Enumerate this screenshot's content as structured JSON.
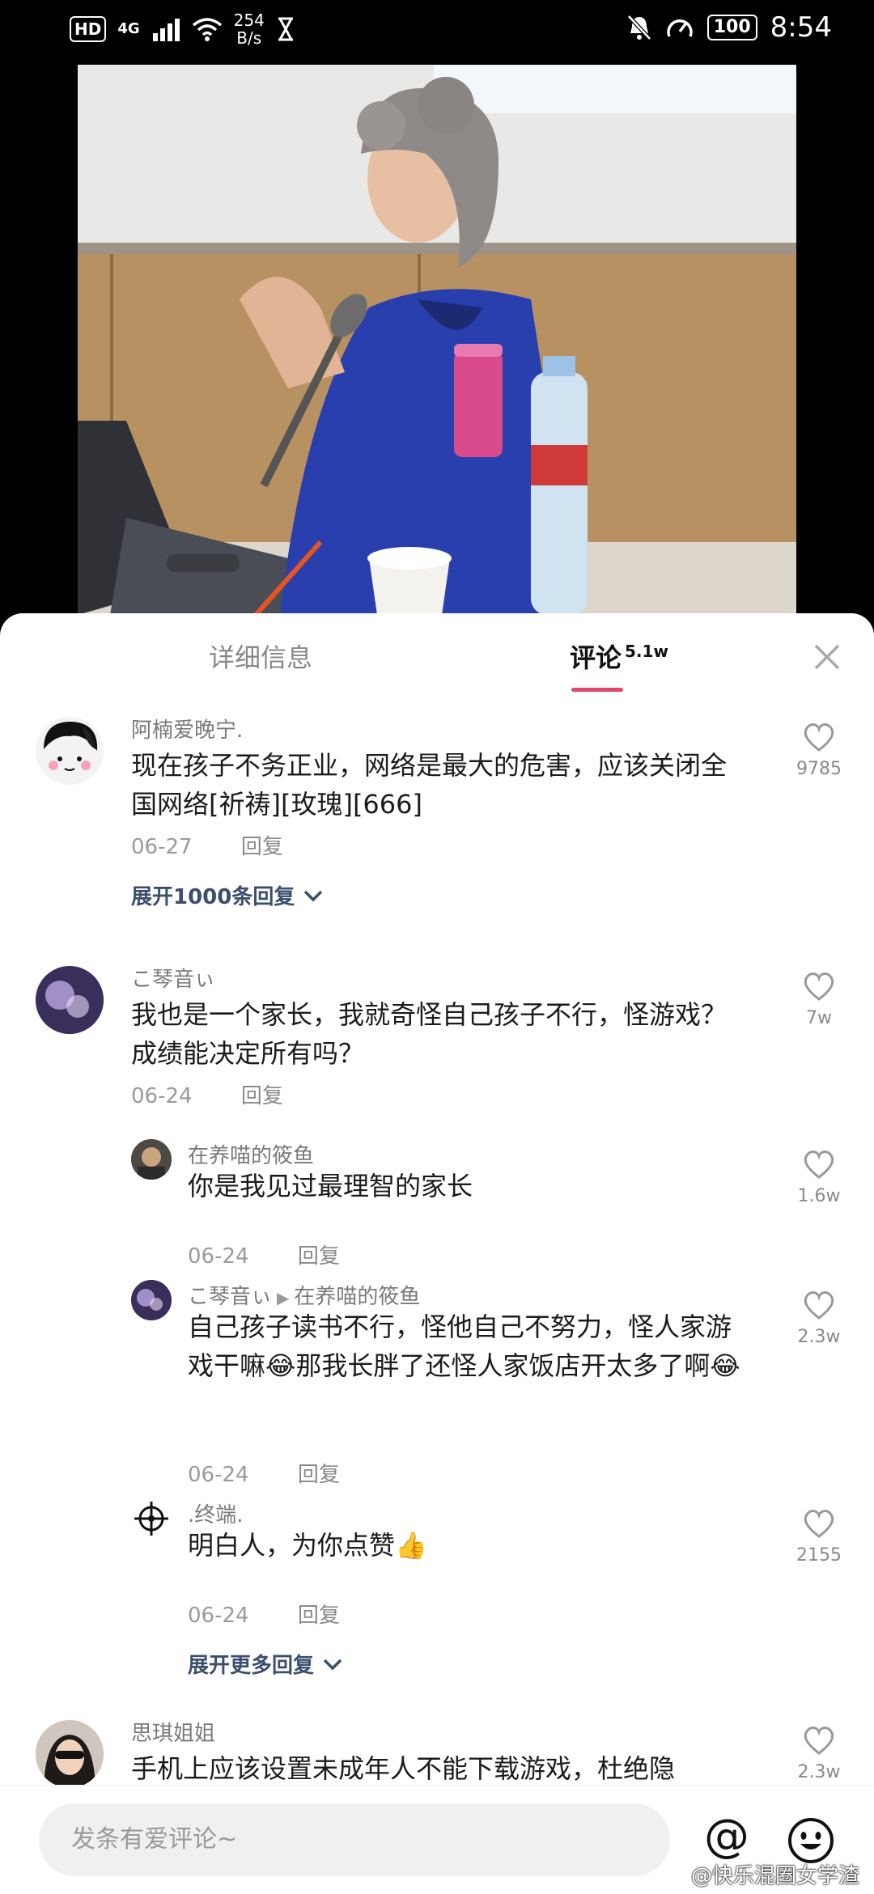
{
  "status_bar": {
    "hd": "HD",
    "network": "4G",
    "speed_value": "254",
    "speed_unit": "B/s",
    "battery": "100",
    "time": "8:54"
  },
  "tabs": {
    "details": "详细信息",
    "comments": "评论",
    "comments_count": "5.1w"
  },
  "comments": [
    {
      "username": "阿楠爱晚宁.",
      "text": "现在孩子不务正业，网络是最大的危害，应该关闭全国网络[祈祷][玫瑰][666]",
      "date": "06-27",
      "reply_label": "回复",
      "likes": "9785",
      "expand": "展开1000条回复"
    },
    {
      "username": "こ琴音ぃ",
      "text": "我也是一个家长，我就奇怪自己孩子不行，怪游戏？成绩能决定所有吗？",
      "date": "06-24",
      "reply_label": "回复",
      "likes": "7w",
      "replies": [
        {
          "username": "在养喵的筱鱼",
          "text": "你是我见过最理智的家长",
          "date": "06-24",
          "reply_label": "回复",
          "likes": "1.6w"
        },
        {
          "username": "こ琴音ぃ",
          "reply_to": "在养喵的筱鱼",
          "text": "自己孩子读书不行，怪他自己不努力，怪人家游戏干嘛😂那我长胖了还怪人家饭店开太多了啊😂",
          "date": "06-24",
          "reply_label": "回复",
          "likes": "2.3w"
        },
        {
          "username": ".终端.",
          "text": "明白人，为你点赞👍",
          "date": "06-24",
          "reply_label": "回复",
          "likes": "2155"
        }
      ],
      "expand": "展开更多回复"
    },
    {
      "username": "思琪姐姐",
      "text": "手机上应该设置未成年人不能下载游戏，杜绝隐",
      "likes": "2.3w"
    }
  ],
  "input": {
    "placeholder": "发条有爱评论~"
  },
  "watermark": "@快乐混圈女学渣",
  "colors": {
    "accent": "#e2466d",
    "link": "#3b4f6d"
  }
}
